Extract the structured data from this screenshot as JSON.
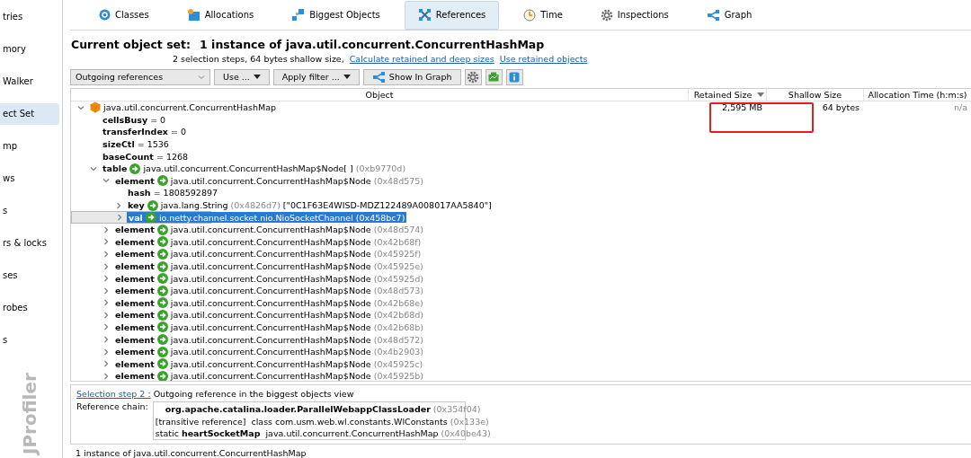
{
  "sidebar": {
    "items": [
      {
        "label": "tries",
        "selected": false
      },
      {
        "label": "mory",
        "selected": false
      },
      {
        "label": "Walker",
        "selected": false
      },
      {
        "label": "ect Set",
        "selected": true
      },
      {
        "label": "mp",
        "selected": false
      },
      {
        "label": "ws",
        "selected": false
      },
      {
        "label": "s",
        "selected": false
      },
      {
        "label": "rs & locks",
        "selected": false
      },
      {
        "label": "ses",
        "selected": false
      },
      {
        "label": "robes",
        "selected": false
      },
      {
        "label": "s",
        "selected": false
      }
    ],
    "brand": "JProfiler"
  },
  "tabs": [
    {
      "label": "Classes",
      "kind": "classes",
      "selected": false
    },
    {
      "label": "Allocations",
      "kind": "allocations",
      "selected": false
    },
    {
      "label": "Biggest Objects",
      "kind": "biggest",
      "selected": false
    },
    {
      "label": "References",
      "kind": "references",
      "selected": true
    },
    {
      "label": "Time",
      "kind": "time",
      "selected": false
    },
    {
      "label": "Inspections",
      "kind": "inspections",
      "selected": false
    },
    {
      "label": "Graph",
      "kind": "graph",
      "selected": false
    }
  ],
  "header": {
    "label": "Current object set:",
    "value": "1 instance of java.util.concurrent.ConcurrentHashMap",
    "summary": "2 selection steps, 64 bytes shallow size,",
    "links": [
      "Calculate retained and deep sizes",
      "Use retained objects"
    ]
  },
  "toolbar": {
    "view_select": "Outgoing references",
    "buttons": [
      {
        "label": "Use ...",
        "kind": "menu"
      },
      {
        "label": "Apply filter ...",
        "kind": "menu"
      },
      {
        "label": "Show In Graph",
        "kind": "graph"
      }
    ]
  },
  "table": {
    "columns": [
      {
        "label": "Object",
        "sorted": false
      },
      {
        "label": "Retained Size",
        "sorted": true
      },
      {
        "label": "Shallow Size",
        "sorted": false
      },
      {
        "label": "Allocation Time (h:m:s)",
        "sorted": false
      }
    ],
    "rows": [
      {
        "kind": "object",
        "type": "java.util.concurrent.ConcurrentHashMap",
        "retained": "2,595 MB",
        "shallow": "64 bytes",
        "alloc": "n/a",
        "expanded": true,
        "selected": false,
        "highlighted": true,
        "children": [
          {
            "kind": "field",
            "name": "cellsBusy",
            "value": "= 0",
            "selected": false
          },
          {
            "kind": "field",
            "name": "transferIndex",
            "value": "= 0",
            "selected": false
          },
          {
            "kind": "field",
            "name": "sizeCtl",
            "value": "= 1536",
            "selected": false
          },
          {
            "kind": "field",
            "name": "baseCount",
            "value": "= 1268",
            "selected": false
          },
          {
            "kind": "ref",
            "name": "table",
            "type": "java.util.concurrent.ConcurrentHashMap$Node[ ]",
            "address": "(0xb9770d)",
            "expanded": true,
            "selected": false,
            "children": [
              {
                "kind": "ref",
                "name": "element",
                "type": "java.util.concurrent.ConcurrentHashMap$Node",
                "address": "(0x48d575)",
                "expanded": true,
                "selected": false,
                "children": [
                  {
                    "kind": "field",
                    "name": "hash",
                    "value": "= 1808592897",
                    "selected": false
                  },
                  {
                    "kind": "ref",
                    "name": "key",
                    "type": "java.lang.String",
                    "address": "(0x4826d7)",
                    "extra": "[\"0C1F63E4WISD-MDZ122489A008017AA5840\"]",
                    "expanded": false,
                    "selected": false
                  },
                  {
                    "kind": "ref",
                    "name": "val",
                    "type": "io.netty.channel.socket.nio.NioSocketChannel",
                    "address": "(0x458bc7)",
                    "expanded": false,
                    "selected": true
                  }
                ]
              },
              {
                "kind": "ref",
                "name": "element",
                "type": "java.util.concurrent.ConcurrentHashMap$Node",
                "address": "(0x48d574)",
                "expanded": false,
                "selected": false
              },
              {
                "kind": "ref",
                "name": "element",
                "type": "java.util.concurrent.ConcurrentHashMap$Node",
                "address": "(0x42b68f)",
                "expanded": false,
                "selected": false
              },
              {
                "kind": "ref",
                "name": "element",
                "type": "java.util.concurrent.ConcurrentHashMap$Node",
                "address": "(0x45925f)",
                "expanded": false,
                "selected": false
              },
              {
                "kind": "ref",
                "name": "element",
                "type": "java.util.concurrent.ConcurrentHashMap$Node",
                "address": "(0x45925e)",
                "expanded": false,
                "selected": false
              },
              {
                "kind": "ref",
                "name": "element",
                "type": "java.util.concurrent.ConcurrentHashMap$Node",
                "address": "(0x45925d)",
                "expanded": false,
                "selected": false
              },
              {
                "kind": "ref",
                "name": "element",
                "type": "java.util.concurrent.ConcurrentHashMap$Node",
                "address": "(0x48d573)",
                "expanded": false,
                "selected": false
              },
              {
                "kind": "ref",
                "name": "element",
                "type": "java.util.concurrent.ConcurrentHashMap$Node",
                "address": "(0x42b68e)",
                "expanded": false,
                "selected": false
              },
              {
                "kind": "ref",
                "name": "element",
                "type": "java.util.concurrent.ConcurrentHashMap$Node",
                "address": "(0x42b68d)",
                "expanded": false,
                "selected": false
              },
              {
                "kind": "ref",
                "name": "element",
                "type": "java.util.concurrent.ConcurrentHashMap$Node",
                "address": "(0x42b68b)",
                "expanded": false,
                "selected": false
              },
              {
                "kind": "ref",
                "name": "element",
                "type": "java.util.concurrent.ConcurrentHashMap$Node",
                "address": "(0x48d572)",
                "expanded": false,
                "selected": false
              },
              {
                "kind": "ref",
                "name": "element",
                "type": "java.util.concurrent.ConcurrentHashMap$Node",
                "address": "(0x4b2903)",
                "expanded": false,
                "selected": false
              },
              {
                "kind": "ref",
                "name": "element",
                "type": "java.util.concurrent.ConcurrentHashMap$Node",
                "address": "(0x45925c)",
                "expanded": false,
                "selected": false
              },
              {
                "kind": "ref",
                "name": "element",
                "type": "java.util.concurrent.ConcurrentHashMap$Node",
                "address": "(0x45925b)",
                "expanded": false,
                "selected": false
              }
            ]
          }
        ]
      }
    ]
  },
  "details": {
    "step_link": "Selection step 2 :",
    "step_text": "Outgoing reference in the biggest objects view",
    "chain_label": "Reference chain:",
    "chain": [
      {
        "kind": "object",
        "type": "org.apache.catalina.loader.ParallelWebappClassLoader",
        "address": "(0x354f04)"
      },
      {
        "kind": "ref",
        "prefix": "[transitive reference]",
        "type": "class com.usm.web.wl.constants.WlConstants",
        "address": "(0x133e)"
      },
      {
        "kind": "ref",
        "prefix": "static",
        "name": "heartSocketMap",
        "type": "java.util.concurrent.ConcurrentHashMap",
        "address": "(0x40be43)"
      }
    ]
  },
  "status_bar": "1 instance of java.util.concurrent.ConcurrentHashMap"
}
